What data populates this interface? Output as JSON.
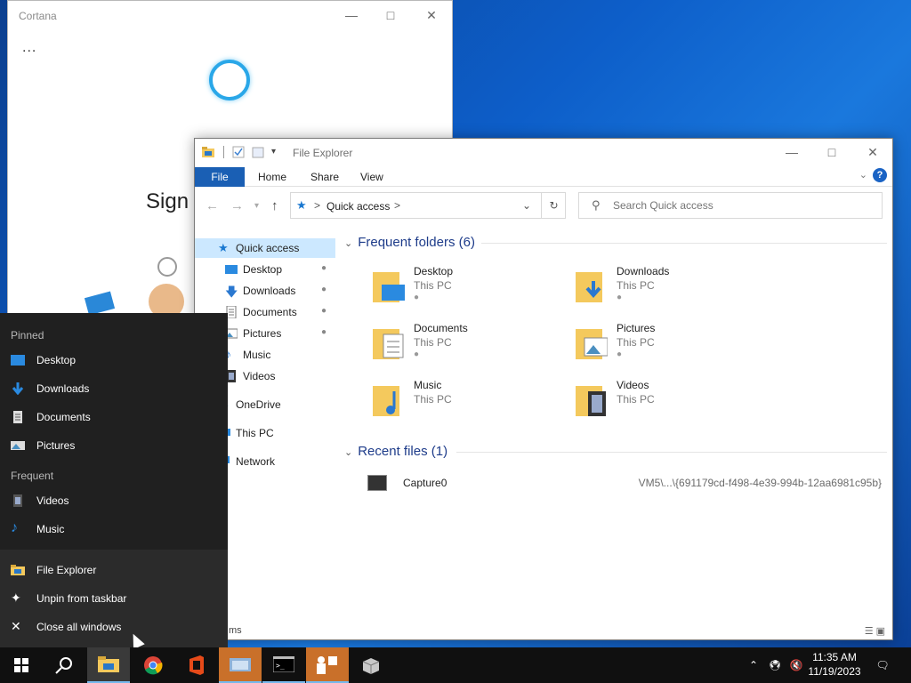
{
  "cortana": {
    "title": "Cortana",
    "more": "...",
    "sign_in_text": "Sign i"
  },
  "explorer": {
    "title": "File Explorer",
    "ribbon_tabs": [
      "File",
      "Home",
      "Share",
      "View"
    ],
    "help": "?",
    "address": {
      "separator": ">",
      "path": "Quick access",
      "trail": ">"
    },
    "search_placeholder": "Search Quick access",
    "nav": [
      {
        "label": "Quick access",
        "selected": true
      },
      {
        "label": "Desktop",
        "pinned": true
      },
      {
        "label": "Downloads",
        "pinned": true
      },
      {
        "label": "Documents",
        "pinned": true
      },
      {
        "label": "Pictures",
        "pinned": true
      },
      {
        "label": "Music"
      },
      {
        "label": "Videos"
      },
      {
        "label": "OneDrive"
      },
      {
        "label": "This PC"
      },
      {
        "label": "Network"
      }
    ],
    "frequent_header": "Frequent folders (6)",
    "folders": [
      {
        "name": "Desktop",
        "location": "This PC",
        "pinned": true
      },
      {
        "name": "Downloads",
        "location": "This PC",
        "pinned": true
      },
      {
        "name": "Documents",
        "location": "This PC",
        "pinned": true
      },
      {
        "name": "Pictures",
        "location": "This PC",
        "pinned": true
      },
      {
        "name": "Music",
        "location": "This PC"
      },
      {
        "name": "Videos",
        "location": "This PC"
      }
    ],
    "recent_header": "Recent files (1)",
    "recent_files": [
      {
        "name": "Capture0",
        "path": "VM5\\...\\{691179cd-f498-4e39-994b-12aa6981c95b}"
      }
    ],
    "status_items": "ms"
  },
  "jumplist": {
    "pinned_header": "Pinned",
    "pinned": [
      "Desktop",
      "Downloads",
      "Documents",
      "Pictures"
    ],
    "frequent_header": "Frequent",
    "frequent": [
      "Videos",
      "Music"
    ],
    "actions": [
      "File Explorer",
      "Unpin from taskbar",
      "Close all windows"
    ]
  },
  "taskbar": {
    "time": "11:35 AM",
    "date": "11/19/2023"
  },
  "colors": {
    "accent": "#1a5fb4",
    "selection": "#cce8ff",
    "folder_yellow": "#f4c95d",
    "jumplist_bg": "#202020",
    "taskbar_bg": "#101010"
  }
}
